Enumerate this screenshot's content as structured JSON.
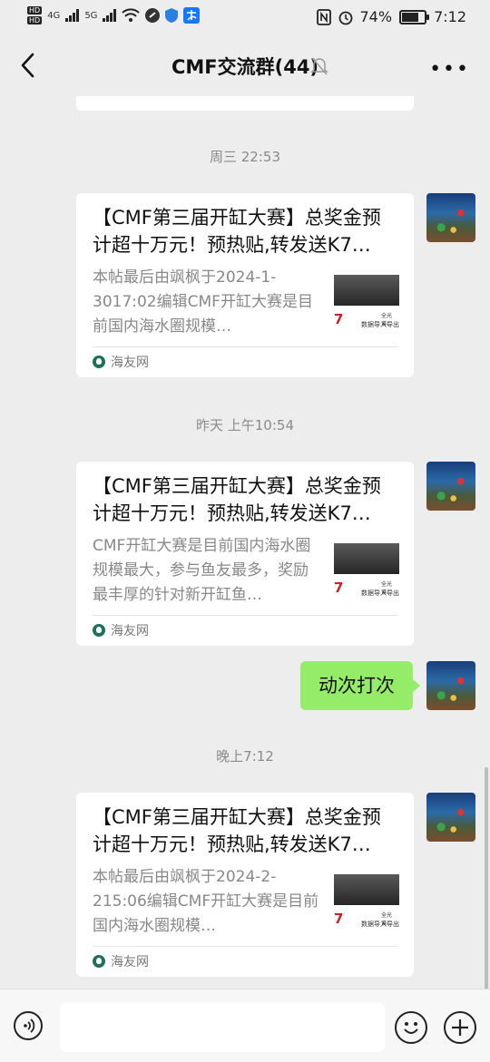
{
  "status_bar": {
    "hd1": "HD",
    "hd2": "HD",
    "net1": "4G",
    "net2": "5G",
    "battery": "74%",
    "time": "7:12"
  },
  "header": {
    "title": "CMF交流群(44)"
  },
  "messages": [
    {
      "type": "time",
      "text": "周三 22:53"
    },
    {
      "type": "card",
      "title": "【CMF第三届开缸大赛】总奖金预计超十万元！预热贴,转发送K7…",
      "desc": "本帖最后由飒枫于2024-1-3017:02编辑CMF开缸大赛是目前国内海水圈规模…",
      "source": "海友网",
      "thumb_text": "数据导入导出",
      "thumb_small": "全光谱-"
    },
    {
      "type": "time",
      "text": "昨天 上午10:54"
    },
    {
      "type": "card",
      "title": "【CMF第三届开缸大赛】总奖金预计超十万元！预热贴,转发送K7…",
      "desc": "CMF开缸大赛是目前国内海水圈规模最大，参与鱼友最多，奖励最丰厚的针对新开缸鱼…",
      "source": "海友网",
      "thumb_text": "数据导入导出",
      "thumb_small": "全光谱-"
    },
    {
      "type": "text",
      "text": "动次打次"
    },
    {
      "type": "time",
      "text": "晚上7:12"
    },
    {
      "type": "card",
      "title": "【CMF第三届开缸大赛】总奖金预计超十万元！预热贴,转发送K7…",
      "desc": "本帖最后由飒枫于2024-2-215:06编辑CMF开缸大赛是目前国内海水圈规模…",
      "source": "海友网",
      "thumb_text": "数据导入导出",
      "thumb_small": "全光谱-"
    }
  ],
  "colors": {
    "background": "#ededed",
    "bubble_green": "#95ec69",
    "card": "#ffffff",
    "timestamp": "#8a8a8a"
  },
  "icons": [
    "back-arrow-icon",
    "mute-bell-icon",
    "more-dots-icon",
    "voice-icon",
    "emoji-icon",
    "plus-icon"
  ]
}
